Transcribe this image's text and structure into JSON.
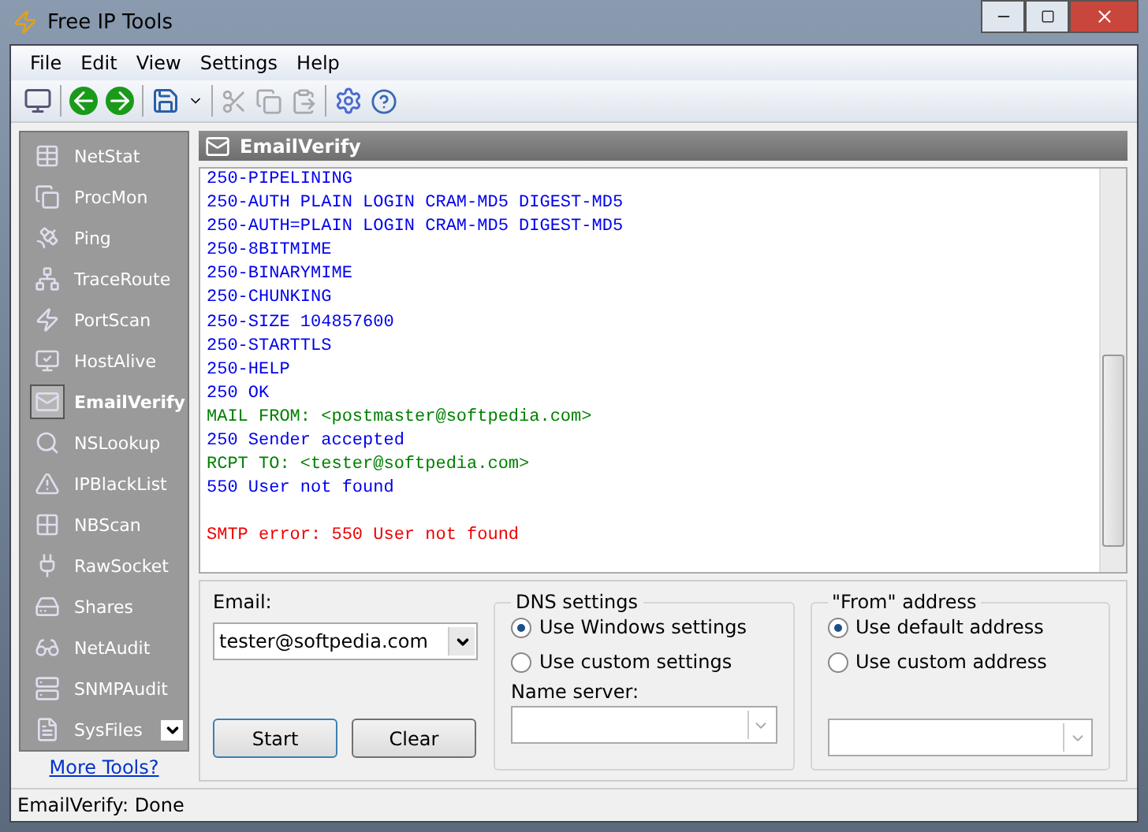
{
  "window": {
    "title": "Free IP Tools"
  },
  "menu": [
    "File",
    "Edit",
    "View",
    "Settings",
    "Help"
  ],
  "sidebar": {
    "items": [
      {
        "label": "NetStat",
        "selected": false
      },
      {
        "label": "ProcMon",
        "selected": false
      },
      {
        "label": "Ping",
        "selected": false
      },
      {
        "label": "TraceRoute",
        "selected": false
      },
      {
        "label": "PortScan",
        "selected": false
      },
      {
        "label": "HostAlive",
        "selected": false
      },
      {
        "label": "EmailVerify",
        "selected": true
      },
      {
        "label": "NSLookup",
        "selected": false
      },
      {
        "label": "IPBlackList",
        "selected": false
      },
      {
        "label": "NBScan",
        "selected": false
      },
      {
        "label": "RawSocket",
        "selected": false
      },
      {
        "label": "Shares",
        "selected": false
      },
      {
        "label": "NetAudit",
        "selected": false
      },
      {
        "label": "SNMPAudit",
        "selected": false
      },
      {
        "label": "SysFiles",
        "selected": false
      }
    ],
    "link": "More Tools?"
  },
  "panel": {
    "title": "EmailVerify"
  },
  "log": [
    {
      "kind": "response",
      "text": "250-PIPELINING"
    },
    {
      "kind": "response",
      "text": "250-AUTH PLAIN LOGIN CRAM-MD5 DIGEST-MD5"
    },
    {
      "kind": "response",
      "text": "250-AUTH=PLAIN LOGIN CRAM-MD5 DIGEST-MD5"
    },
    {
      "kind": "response",
      "text": "250-8BITMIME"
    },
    {
      "kind": "response",
      "text": "250-BINARYMIME"
    },
    {
      "kind": "response",
      "text": "250-CHUNKING"
    },
    {
      "kind": "response",
      "text": "250-SIZE 104857600"
    },
    {
      "kind": "response",
      "text": "250-STARTTLS"
    },
    {
      "kind": "response",
      "text": "250-HELP"
    },
    {
      "kind": "response",
      "text": "250 OK"
    },
    {
      "kind": "command",
      "text": "MAIL FROM: <postmaster@softpedia.com>"
    },
    {
      "kind": "response",
      "text": "250 Sender accepted"
    },
    {
      "kind": "command",
      "text": "RCPT TO: <tester@softpedia.com>"
    },
    {
      "kind": "response",
      "text": "550 User not found"
    },
    {
      "kind": "blank"
    },
    {
      "kind": "error",
      "text": "SMTP error: 550 User not found"
    }
  ],
  "email": {
    "label": "Email:",
    "value": "tester@softpedia.com"
  },
  "buttons": [
    {
      "label": "Start",
      "focused": true
    },
    {
      "label": "Clear",
      "focused": false
    }
  ],
  "dns": {
    "title": "DNS settings",
    "options": [
      {
        "label": "Use Windows settings",
        "selected": true
      },
      {
        "label": "Use custom settings",
        "selected": false
      }
    ],
    "server_label": "Name server:"
  },
  "from": {
    "title": "\"From\" address",
    "options": [
      {
        "label": "Use default address",
        "selected": true
      },
      {
        "label": "Use custom address",
        "selected": false
      }
    ]
  },
  "status_bar": "EmailVerify: Done"
}
